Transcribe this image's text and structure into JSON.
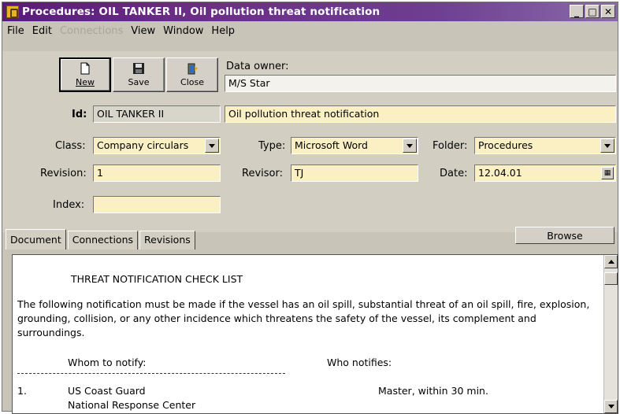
{
  "window": {
    "title": "Procedures: OIL TANKER II, Oil pollution threat notification",
    "controls": {
      "minimize": "_",
      "maximize": "□",
      "close": "✕"
    }
  },
  "menu": {
    "items": [
      {
        "label": "File",
        "enabled": true
      },
      {
        "label": "Edit",
        "enabled": true
      },
      {
        "label": "Connections",
        "enabled": false
      },
      {
        "label": "View",
        "enabled": true
      },
      {
        "label": "Window",
        "enabled": true
      },
      {
        "label": "Help",
        "enabled": true
      }
    ]
  },
  "toolbar": {
    "new_label": "New",
    "save_label": "Save",
    "close_label": "Close"
  },
  "form": {
    "data_owner_label": "Data owner:",
    "data_owner_value": "M/S Star",
    "id_label": "Id:",
    "id_value": "OIL TANKER II",
    "title_value": "Oil pollution threat notification",
    "class_label": "Class:",
    "class_value": "Company circulars",
    "type_label": "Type:",
    "type_value": "Microsoft Word",
    "folder_label": "Folder:",
    "folder_value": "Procedures",
    "revision_label": "Revision:",
    "revision_value": "1",
    "revisor_label": "Revisor:",
    "revisor_value": "TJ",
    "date_label": "Date:",
    "date_value": "12.04.01",
    "index_label": "Index:",
    "index_value": ""
  },
  "tabs": {
    "items": [
      "Document",
      "Connections",
      "Revisions"
    ],
    "active": "Document"
  },
  "browse_label": "Browse",
  "document": {
    "heading": "THREAT NOTIFICATION CHECK LIST",
    "paragraph": "The following notification must be made if the vessel has an oil spill, substantial threat of an oil spill, fire, explosion, grounding, collision, or any other incidence which threatens the safety of the vessel, its complement and surroundings.",
    "col_whom": "Whom to notify:",
    "col_who": "Who notifies:",
    "rows": [
      {
        "num": "1.",
        "whom_line1": "US Coast Guard",
        "whom_line2": "National Response Center",
        "who": "Master, within 30 min."
      }
    ]
  },
  "colors": {
    "titlebar": "#6b2d86",
    "input_bg": "#fbf0c4",
    "panel_bg": "#d2cfc2"
  }
}
